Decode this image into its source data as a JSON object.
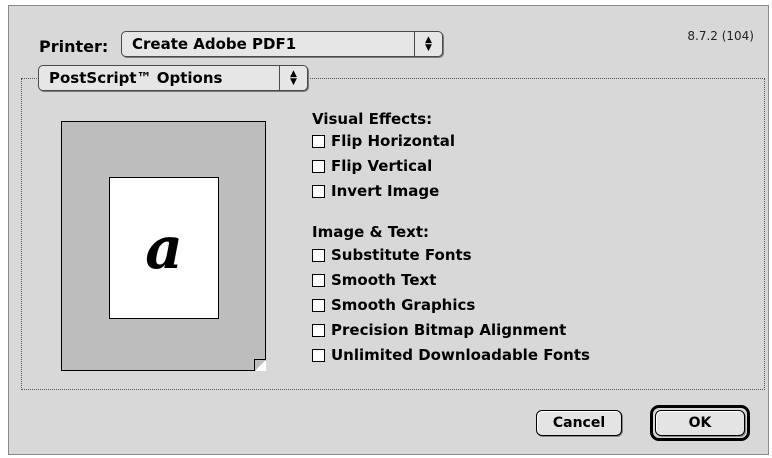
{
  "printer": {
    "label": "Printer:",
    "selected": "Create Adobe PDF1",
    "arrow_icon": "updown-arrows-icon"
  },
  "version": "8.7.2 (104)",
  "panel_selector": {
    "selected": "PostScript™ Options"
  },
  "preview": {
    "glyph": "a"
  },
  "visual_effects": {
    "heading": "Visual Effects:",
    "options": [
      {
        "label": "Flip Horizontal",
        "checked": false
      },
      {
        "label": "Flip Vertical",
        "checked": false
      },
      {
        "label": "Invert Image",
        "checked": false
      }
    ]
  },
  "image_text": {
    "heading": "Image & Text:",
    "options": [
      {
        "label": "Substitute Fonts",
        "checked": false
      },
      {
        "label": "Smooth Text",
        "checked": false
      },
      {
        "label": "Smooth Graphics",
        "checked": false
      },
      {
        "label": "Precision Bitmap Alignment",
        "checked": false
      },
      {
        "label": "Unlimited Downloadable Fonts",
        "checked": false
      }
    ]
  },
  "buttons": {
    "cancel": "Cancel",
    "ok": "OK"
  }
}
